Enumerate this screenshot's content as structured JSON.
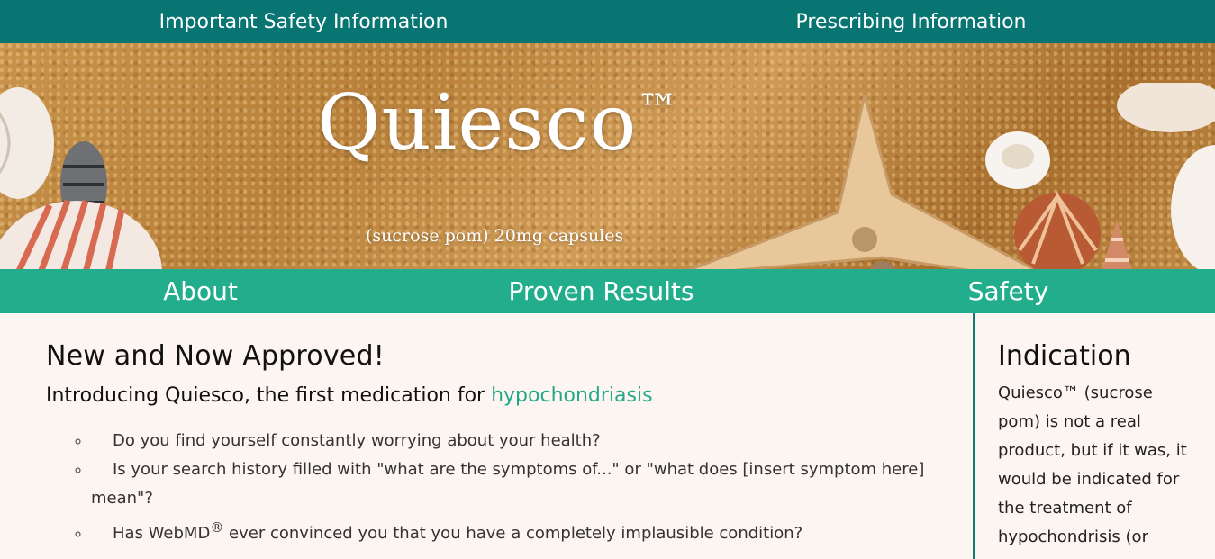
{
  "topbar": {
    "safety_link": "Important Safety Information",
    "prescribing_link": "Prescribing Information"
  },
  "hero": {
    "title": "Quiesco",
    "tm": "™",
    "subtitle": "(sucrose pom) 20mg capsules"
  },
  "nav": {
    "items": [
      "About",
      "Proven Results",
      "Safety"
    ]
  },
  "main": {
    "heading": "New and Now Approved!",
    "intro_prefix": "Introducing Quiesco, the first medication for ",
    "intro_highlight": "hypochondriasis",
    "bullets": [
      "Do you find yourself constantly worrying about your health?",
      "Is your search history filled with \"what are the symptoms of...\" or \"what does [insert symptom here]",
      "mean\"?",
      "Has WebMD",
      "®",
      " ever convinced you that you have a completely implausible condition?"
    ]
  },
  "sidebar": {
    "heading": "Indication",
    "text": "Quiesco™ (sucrose pom) is not a real product, but if it was, it would be indicated for the treatment of hypochondrisis (or"
  },
  "colors": {
    "topbar": "#087573",
    "nav": "#22ae8d",
    "accent": "#23a88a",
    "background": "#fdf5f1"
  }
}
